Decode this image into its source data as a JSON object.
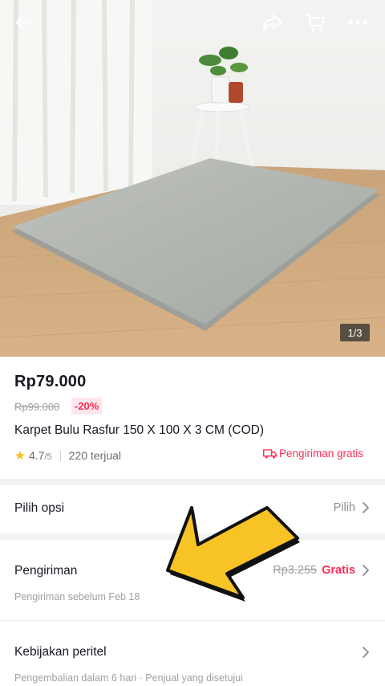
{
  "hero": {
    "image_counter": "1/3",
    "icons": {
      "back": "back-arrow-icon",
      "share": "share-icon",
      "cart": "cart-icon",
      "more": "more-icon"
    }
  },
  "product": {
    "price": "Rp79.000",
    "original_price": "Rp99.000",
    "discount": "-20%",
    "title": "Karpet Bulu Rasfur 150 X 100 X 3 CM (COD)",
    "rating": "4.7",
    "rating_scale": "/5",
    "sold": "220 terjual",
    "free_shipping": "Pengiriman gratis"
  },
  "options": {
    "label": "Pilih opsi",
    "value": "Pilih"
  },
  "shipping": {
    "label": "Pengiriman",
    "original_fee": "Rp3.255",
    "fee": "Gratis",
    "estimate": "Pengiriman sebelum Feb 18"
  },
  "policy": {
    "label": "Kebijakan peritel",
    "detail": "Pengembalian dalam 6 hari · Penjual yang disetujui"
  },
  "colors": {
    "accent": "#fe2c55",
    "star": "#f7c325",
    "overlay_arrow": "#f7c325"
  }
}
